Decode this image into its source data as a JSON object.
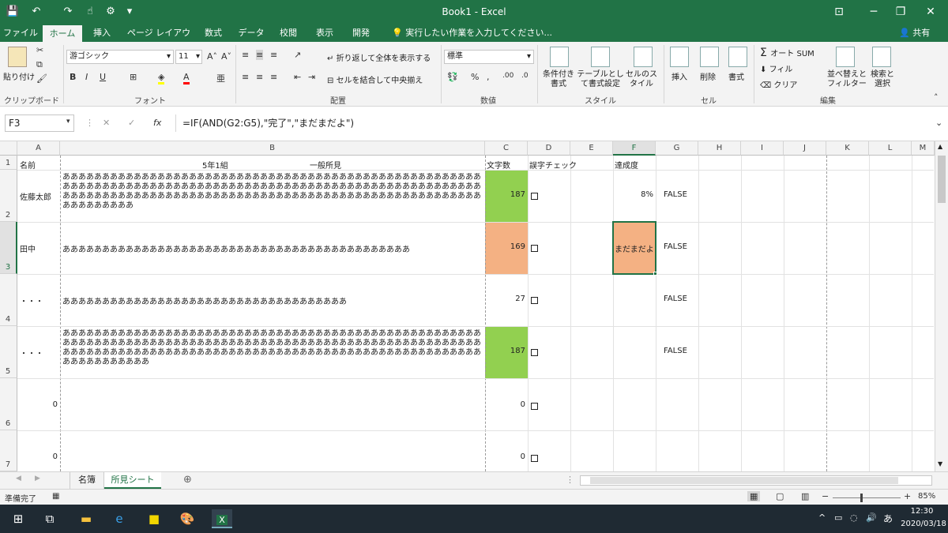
{
  "window": {
    "title": "Book1 - Excel",
    "minimize": "─",
    "restore": "❐",
    "close": "✕",
    "ribbon_display": "⊡"
  },
  "qat": {
    "save": "💾",
    "undo": "↶",
    "redo": "↷",
    "touch": "☝",
    "customize": "▾"
  },
  "tabs": [
    "ファイル",
    "ホーム",
    "挿入",
    "ページ レイアウト",
    "数式",
    "データ",
    "校閲",
    "表示",
    "開発"
  ],
  "active_tab": "ホーム",
  "tell_me": "実行したい作業を入力してください...",
  "share": "共有",
  "ribbon": {
    "clipboard": {
      "label": "クリップボード",
      "paste": "貼り付け"
    },
    "font": {
      "label": "フォント",
      "name": "游ゴシック",
      "size": "11",
      "bold": "B",
      "italic": "I",
      "underline": "U"
    },
    "alignment": {
      "label": "配置",
      "wrap": "折り返して全体を表示する",
      "merge": "セルを結合して中央揃え"
    },
    "number": {
      "label": "数値",
      "format": "標準"
    },
    "styles": {
      "label": "スタイル",
      "conditional": "条件付き書式",
      "table": "テーブルとして書式設定",
      "cell_styles": "セルのスタイル"
    },
    "cells": {
      "label": "セル",
      "insert": "挿入",
      "delete": "削除",
      "format": "書式"
    },
    "editing": {
      "label": "編集",
      "autosum": "オート SUM",
      "fill": "フィル",
      "clear": "クリア",
      "sort": "並べ替えとフィルター",
      "find": "検索と選択"
    }
  },
  "formula_bar": {
    "name_box": "F3",
    "formula": "=IF(AND(G2:G5),\"完了\",\"まだまだよ\")",
    "fx": "fx"
  },
  "columns": [
    "A",
    "B",
    "C",
    "D",
    "E",
    "F",
    "G",
    "H",
    "I",
    "J",
    "K",
    "L",
    "M"
  ],
  "rows": [
    "1",
    "2",
    "3",
    "4",
    "5",
    "6",
    "7"
  ],
  "cells": {
    "A1": "名前",
    "B1_left": "5年1組",
    "B1_right": "一般所見",
    "C1": "文字数",
    "D1": "誤字チェック",
    "F1": "達成度",
    "A2": "佐藤太郎",
    "B2": "ああああああああああああああああああああああああああああああああああああああああああああああああああああああああああああああああああああああああああああああああああああああああああああああああああああああああああああああああああああああああああああああああああああああああああああああああああああああああああああああああああああああああ",
    "C2": "187",
    "F2": "8%",
    "G2": "FALSE",
    "A3": "田中",
    "B3": "ああああああああああああああああああああああああああああああああああああああああああああ",
    "C3": "169",
    "F3": "まだまだよ",
    "G3": "FALSE",
    "A4": "・・・",
    "B4": "ああああああああああああああああああああああああああああああああああああ",
    "C4": "27",
    "G4": "FALSE",
    "A5": "・・・",
    "B5": "ああああああああああああああああああああああああああああああああああああああああああああああああああああああああああああああああああああああああああああああああああああああああああああああああああああああああああああああああああああああああああああああああああああああああああああああああああああああああああああああああああああああああああ",
    "C5": "187",
    "G5": "FALSE",
    "A6": "0",
    "C6": "0",
    "A7": "0",
    "C7": "0"
  },
  "sheets": [
    "名簿",
    "所見シート"
  ],
  "active_sheet": "所見シート",
  "status": {
    "ready": "準備完了",
    "zoom": "85%",
    "zoom_level": 0.85
  },
  "taskbar": {
    "time": "12:30",
    "date": "2020/03/18",
    "ime": "あ"
  },
  "colors": {
    "excel_green": "#217346",
    "cell_green": "#92d050",
    "cell_orange": "#f4b183"
  }
}
